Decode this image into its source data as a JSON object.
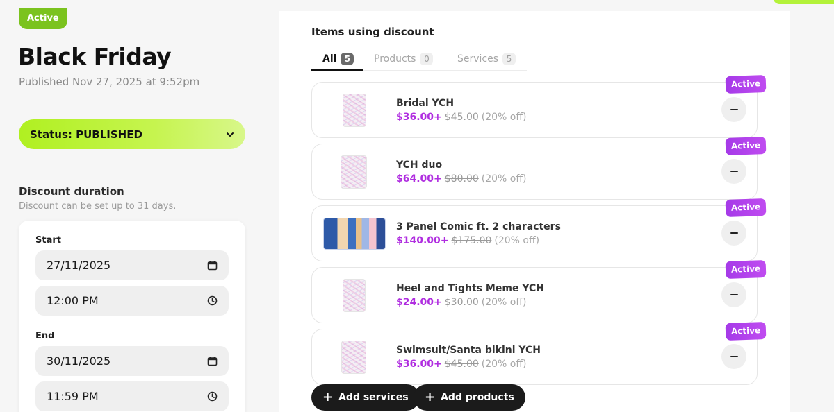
{
  "header": {
    "status_badge": "Active",
    "title": "Black Friday",
    "published": "Published Nov 27, 2025 at 9:52pm"
  },
  "status": {
    "label": "Status: PUBLISHED"
  },
  "duration": {
    "title": "Discount duration",
    "subtitle": "Discount can be set up to 31 days.",
    "start_label": "Start",
    "start_date": "27/11/2025",
    "start_time": "12:00 PM",
    "end_label": "End",
    "end_date": "30/11/2025",
    "end_time": "11:59 PM"
  },
  "items_panel": {
    "title": "Items using discount",
    "tabs": [
      {
        "label": "All",
        "count": "5"
      },
      {
        "label": "Products",
        "count": "0"
      },
      {
        "label": "Services",
        "count": "5"
      }
    ],
    "items": [
      {
        "name": "Bridal YCH",
        "sale_price": "$36.00+",
        "original_price": "$45.00",
        "discount": "(20% off)",
        "badge": "Active"
      },
      {
        "name": "YCH duo",
        "sale_price": "$64.00+",
        "original_price": "$80.00",
        "discount": "(20% off)",
        "badge": "Active"
      },
      {
        "name": "3 Panel Comic ft. 2 characters",
        "sale_price": "$140.00+",
        "original_price": "$175.00",
        "discount": "(20% off)",
        "badge": "Active"
      },
      {
        "name": "Heel and Tights Meme YCH",
        "sale_price": "$24.00+",
        "original_price": "$30.00",
        "discount": "(20% off)",
        "badge": "Active"
      },
      {
        "name": "Swimsuit/Santa bikini YCH",
        "sale_price": "$36.00+",
        "original_price": "$45.00",
        "discount": "(20% off)",
        "badge": "Active"
      }
    ],
    "add_services_label": "Add services",
    "add_products_label": "Add products"
  },
  "colors": {
    "status_green": "#b0f021",
    "badge_green": "#7bc31e",
    "sale_purple": "#b02ee0",
    "badge_purple": "#a53ae8"
  },
  "icons": {
    "status_chevron": "chevron-down-icon",
    "date_picker": "calendar-icon",
    "time_picker": "clock-icon",
    "remove": "minus-icon",
    "add": "plus-icon"
  }
}
